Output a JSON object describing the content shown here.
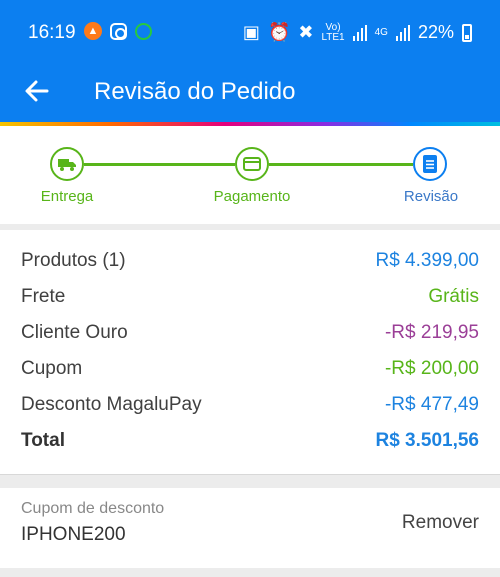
{
  "status": {
    "time": "16:19",
    "volte": "Vo)",
    "lte": "LTE1",
    "net": "4G",
    "battery": "22%"
  },
  "header": {
    "title": "Revisão do Pedido"
  },
  "steps": [
    {
      "label": "Entrega"
    },
    {
      "label": "Pagamento"
    },
    {
      "label": "Revisão"
    }
  ],
  "summary": {
    "rows": [
      {
        "label": "Produtos (1)",
        "value": "R$ 4.399,00",
        "color": "#1d83e0"
      },
      {
        "label": "Frete",
        "value": "Grátis",
        "color": "#58b51a"
      },
      {
        "label": "Cliente Ouro",
        "value": "-R$ 219,95",
        "color": "#9b3f97"
      },
      {
        "label": "Cupom",
        "value": "-R$ 200,00",
        "color": "#58b51a"
      },
      {
        "label": "Desconto MagaluPay",
        "value": "-R$ 477,49",
        "color": "#1d83e0"
      }
    ],
    "total": {
      "label": "Total",
      "value": "R$ 3.501,56",
      "color": "#1d83e0"
    }
  },
  "coupon": {
    "label": "Cupom de desconto",
    "code": "IPHONE200",
    "remove_label": "Remover"
  },
  "colors": {
    "primary": "#0c7ff0",
    "green": "#58b51a",
    "purple": "#9b3f97"
  }
}
